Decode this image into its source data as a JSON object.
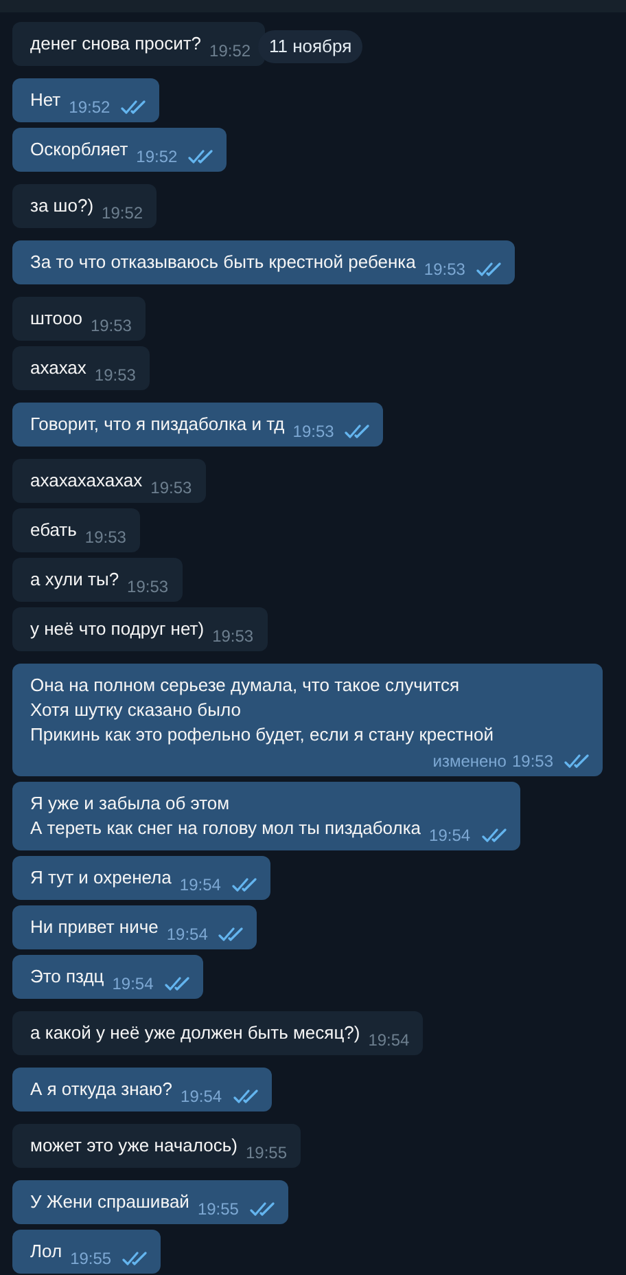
{
  "date_badge": "11 ноября",
  "messages": [
    {
      "kind": "in",
      "text": "денег снова просит?",
      "time": "19:52"
    },
    {
      "kind": "out",
      "text": "Нет",
      "time": "19:52"
    },
    {
      "kind": "out",
      "text": "Оскорбляет",
      "time": "19:52"
    },
    {
      "kind": "in",
      "text": "за шо?)",
      "time": "19:52"
    },
    {
      "kind": "out",
      "text": "За то что отказываюсь быть крестной ребенка",
      "time": "19:53"
    },
    {
      "kind": "in",
      "text": "штооо",
      "time": "19:53"
    },
    {
      "kind": "in",
      "text": "ахахах",
      "time": "19:53"
    },
    {
      "kind": "out",
      "text": "Говорит, что я пиздаболка и тд",
      "time": "19:53"
    },
    {
      "kind": "in",
      "text": "ахахахахахах",
      "time": "19:53"
    },
    {
      "kind": "in",
      "text": "ебать",
      "time": "19:53"
    },
    {
      "kind": "in",
      "text": "а хули ты?",
      "time": "19:53"
    },
    {
      "kind": "in",
      "text": "у неё что подруг нет)",
      "time": "19:53"
    },
    {
      "kind": "out",
      "text": "Она на полном серьезе думала, что такое случится\nХотя шутку сказано было\nПрикинь как это рофельно будет, если я стану крестной",
      "edited": "изменено",
      "time": "19:53"
    },
    {
      "kind": "out",
      "text": "Я уже и забыла об этом\nА тереть как снег на голову мол ты пиздаболка",
      "time": "19:54"
    },
    {
      "kind": "out",
      "text": "Я тут и охренела",
      "time": "19:54"
    },
    {
      "kind": "out",
      "text": "Ни привет ниче",
      "time": "19:54"
    },
    {
      "kind": "out",
      "text": "Это пздц",
      "time": "19:54"
    },
    {
      "kind": "in",
      "text": "а какой у неё уже должен быть месяц?)",
      "time": "19:54"
    },
    {
      "kind": "out",
      "text": "А я откуда знаю?",
      "time": "19:54"
    },
    {
      "kind": "in",
      "text": "может это уже началось)",
      "time": "19:55"
    },
    {
      "kind": "out",
      "text": "У Жени спрашивай",
      "time": "19:55"
    },
    {
      "kind": "out",
      "text": "Лол",
      "time": "19:55"
    }
  ]
}
